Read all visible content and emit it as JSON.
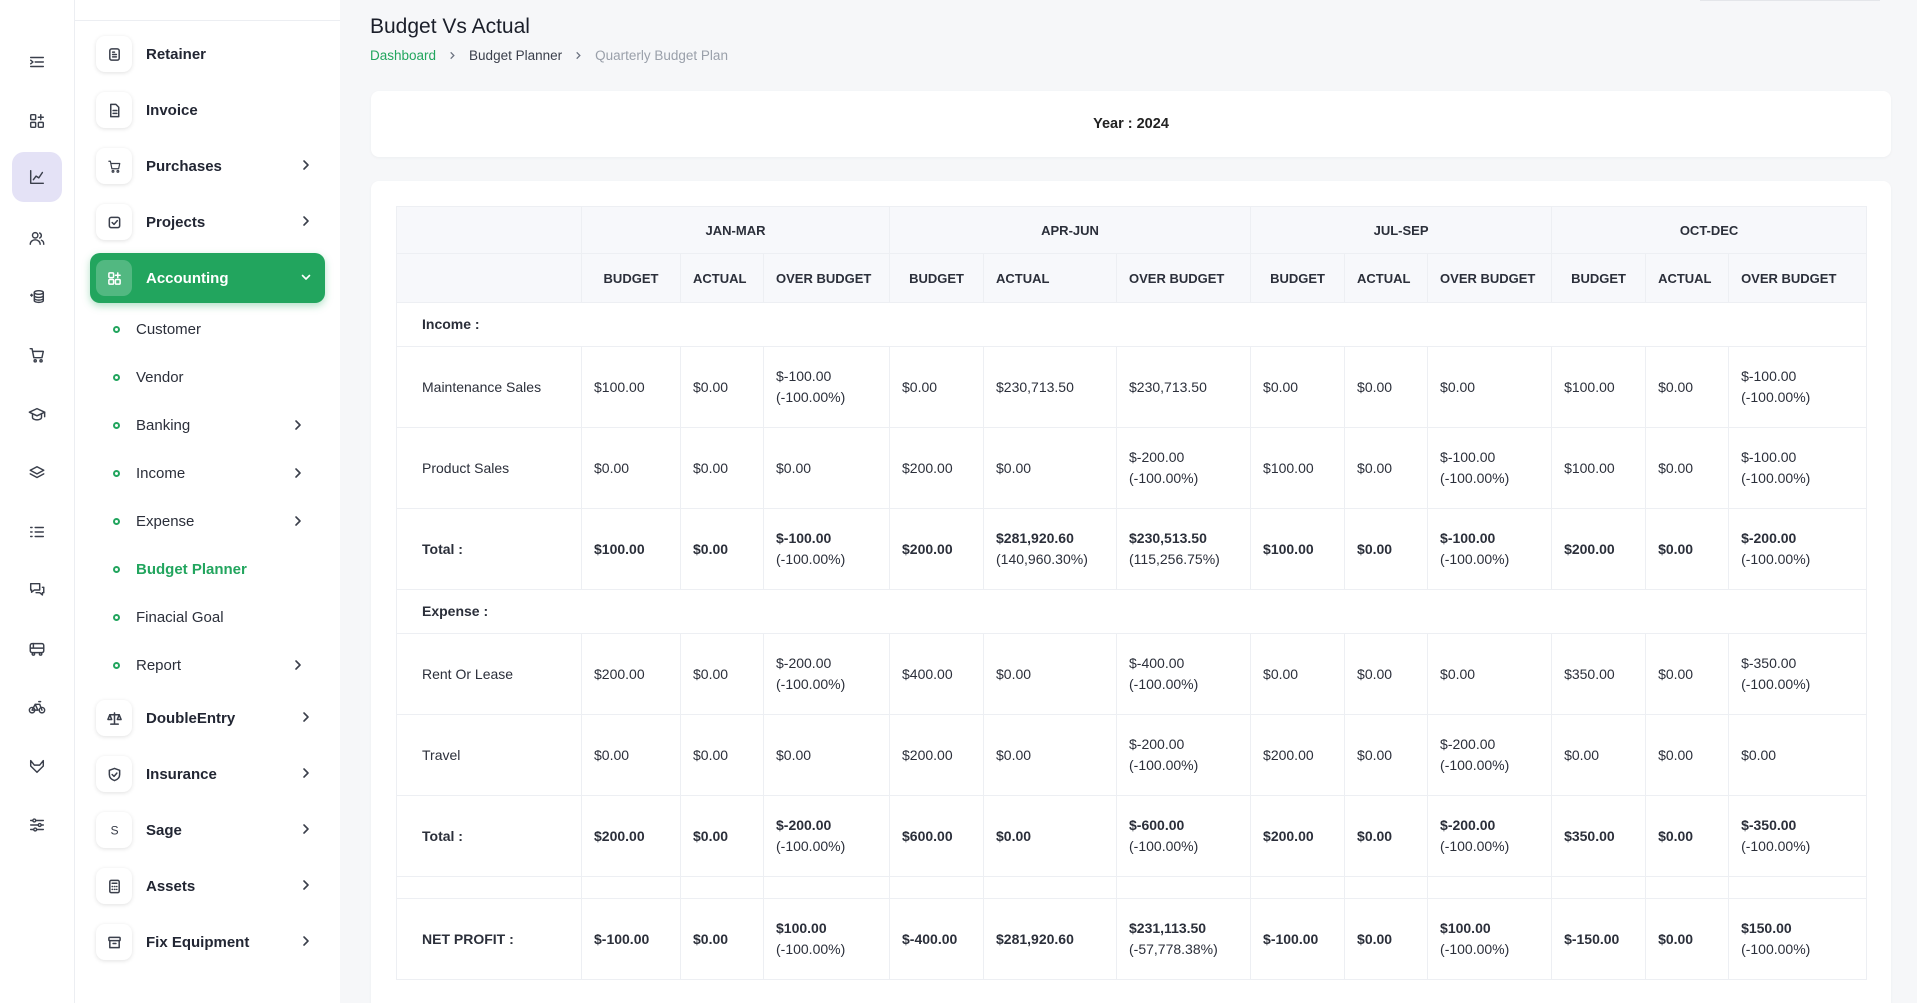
{
  "rail": {
    "icons": [
      "collapse-menu-icon",
      "dashboard-icon",
      "chart-line-icon",
      "users-icon",
      "money-stack-icon",
      "cart-icon",
      "graduation-cap-icon",
      "layers-icon",
      "checklist-icon",
      "chat-icon",
      "truck-icon",
      "bicycle-icon",
      "fox-icon",
      "sliders-icon"
    ],
    "active_index": 2
  },
  "sidebar": {
    "items": [
      {
        "label": "Retainer",
        "icon": "retainer-icon",
        "has_chevron": false
      },
      {
        "label": "Invoice",
        "icon": "invoice-icon",
        "has_chevron": false
      },
      {
        "label": "Purchases",
        "icon": "cart-icon",
        "has_chevron": true
      },
      {
        "label": "Projects",
        "icon": "checkbox-icon",
        "has_chevron": true
      },
      {
        "label": "Accounting",
        "icon": "grid-icon",
        "has_chevron": true,
        "active": true
      }
    ],
    "sub_items": [
      {
        "label": "Customer",
        "has_chevron": false
      },
      {
        "label": "Vendor",
        "has_chevron": false
      },
      {
        "label": "Banking",
        "has_chevron": true
      },
      {
        "label": "Income",
        "has_chevron": true
      },
      {
        "label": "Expense",
        "has_chevron": true
      },
      {
        "label": "Budget Planner",
        "has_chevron": false,
        "active": true
      },
      {
        "label": "Finacial Goal",
        "has_chevron": false
      },
      {
        "label": "Report",
        "has_chevron": true
      }
    ],
    "items_after": [
      {
        "label": "DoubleEntry",
        "icon": "scale-icon",
        "has_chevron": true
      },
      {
        "label": "Insurance",
        "icon": "shield-icon",
        "has_chevron": true
      },
      {
        "label": "Sage",
        "icon": "sage-s-icon",
        "has_chevron": true
      },
      {
        "label": "Assets",
        "icon": "calculator-icon",
        "has_chevron": true
      },
      {
        "label": "Fix Equipment",
        "icon": "archive-icon",
        "has_chevron": true
      }
    ]
  },
  "page": {
    "title": "Budget Vs Actual",
    "breadcrumb": [
      "Dashboard",
      "Budget Planner",
      "Quarterly Budget Plan"
    ],
    "year_label": "Year : 2024"
  },
  "table": {
    "quarters": [
      "JAN-MAR",
      "APR-JUN",
      "JUL-SEP",
      "OCT-DEC"
    ],
    "sub_headers": [
      "BUDGET",
      "ACTUAL",
      "OVER BUDGET"
    ],
    "sections": [
      {
        "label": "Income :",
        "rows": [
          {
            "name": "Maintenance Sales",
            "cells": [
              [
                "$100.00"
              ],
              [
                "$0.00"
              ],
              [
                "$-100.00",
                "(-100.00%)"
              ],
              [
                "$0.00"
              ],
              [
                "$230,713.50"
              ],
              [
                "$230,713.50"
              ],
              [
                "$0.00"
              ],
              [
                "$0.00"
              ],
              [
                "$0.00"
              ],
              [
                "$100.00"
              ],
              [
                "$0.00"
              ],
              [
                "$-100.00",
                "(-100.00%)"
              ]
            ]
          },
          {
            "name": "Product Sales",
            "cells": [
              [
                "$0.00"
              ],
              [
                "$0.00"
              ],
              [
                "$0.00"
              ],
              [
                "$200.00"
              ],
              [
                "$0.00"
              ],
              [
                "$-200.00",
                "(-100.00%)"
              ],
              [
                "$100.00"
              ],
              [
                "$0.00"
              ],
              [
                "$-100.00",
                "(-100.00%)"
              ],
              [
                "$100.00"
              ],
              [
                "$0.00"
              ],
              [
                "$-100.00",
                "(-100.00%)"
              ]
            ]
          }
        ],
        "total": {
          "name": "Total :",
          "cells": [
            [
              "$100.00"
            ],
            [
              "$0.00"
            ],
            [
              "$-100.00",
              "(-100.00%)"
            ],
            [
              "$200.00"
            ],
            [
              "$281,920.60",
              "(140,960.30%)"
            ],
            [
              "$230,513.50",
              "(115,256.75%)"
            ],
            [
              "$100.00"
            ],
            [
              "$0.00"
            ],
            [
              "$-100.00",
              "(-100.00%)"
            ],
            [
              "$200.00"
            ],
            [
              "$0.00"
            ],
            [
              "$-200.00",
              "(-100.00%)"
            ]
          ]
        }
      },
      {
        "label": "Expense :",
        "rows": [
          {
            "name": "Rent Or Lease",
            "cells": [
              [
                "$200.00"
              ],
              [
                "$0.00"
              ],
              [
                "$-200.00",
                "(-100.00%)"
              ],
              [
                "$400.00"
              ],
              [
                "$0.00"
              ],
              [
                "$-400.00",
                "(-100.00%)"
              ],
              [
                "$0.00"
              ],
              [
                "$0.00"
              ],
              [
                "$0.00"
              ],
              [
                "$350.00"
              ],
              [
                "$0.00"
              ],
              [
                "$-350.00",
                "(-100.00%)"
              ]
            ]
          },
          {
            "name": "Travel",
            "cells": [
              [
                "$0.00"
              ],
              [
                "$0.00"
              ],
              [
                "$0.00"
              ],
              [
                "$200.00"
              ],
              [
                "$0.00"
              ],
              [
                "$-200.00",
                "(-100.00%)"
              ],
              [
                "$200.00"
              ],
              [
                "$0.00"
              ],
              [
                "$-200.00",
                "(-100.00%)"
              ],
              [
                "$0.00"
              ],
              [
                "$0.00"
              ],
              [
                "$0.00"
              ]
            ]
          }
        ],
        "total": {
          "name": "Total :",
          "cells": [
            [
              "$200.00"
            ],
            [
              "$0.00"
            ],
            [
              "$-200.00",
              "(-100.00%)"
            ],
            [
              "$600.00"
            ],
            [
              "$0.00"
            ],
            [
              "$-600.00",
              "(-100.00%)"
            ],
            [
              "$200.00"
            ],
            [
              "$0.00"
            ],
            [
              "$-200.00",
              "(-100.00%)"
            ],
            [
              "$350.00"
            ],
            [
              "$0.00"
            ],
            [
              "$-350.00",
              "(-100.00%)"
            ]
          ]
        }
      }
    ],
    "net_profit": {
      "name": "NET PROFIT :",
      "cells": [
        [
          "$-100.00"
        ],
        [
          "$0.00"
        ],
        [
          "$100.00",
          "(-100.00%)"
        ],
        [
          "$-400.00"
        ],
        [
          "$281,920.60"
        ],
        [
          "$231,113.50",
          "(-57,778.38%)"
        ],
        [
          "$-100.00"
        ],
        [
          "$0.00"
        ],
        [
          "$100.00",
          "(-100.00%)"
        ],
        [
          "$-150.00"
        ],
        [
          "$0.00"
        ],
        [
          "$150.00",
          "(-100.00%)"
        ]
      ]
    }
  },
  "colors": {
    "accent": "#22a55e",
    "rail_active": "#e4e2f6"
  }
}
